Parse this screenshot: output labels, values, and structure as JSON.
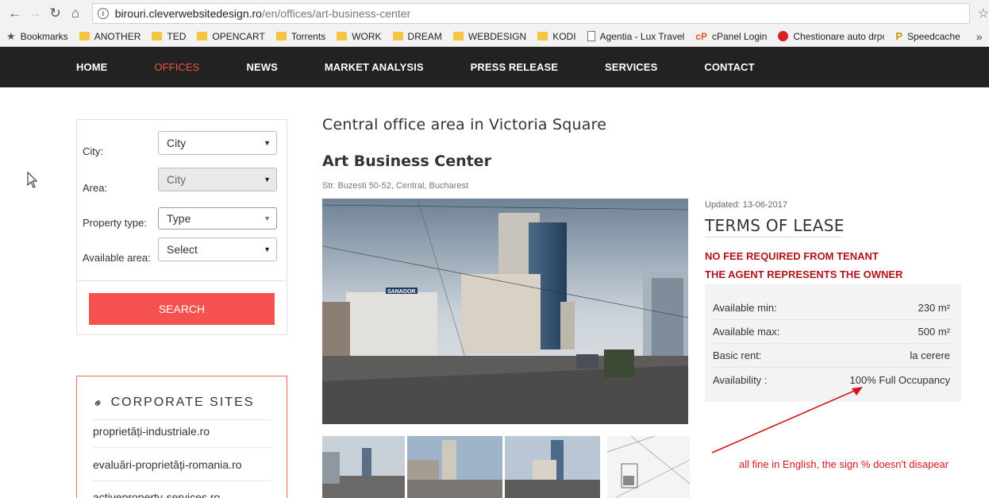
{
  "browser": {
    "url_host": "birouri.cleverwebsitedesign.ro",
    "url_path": "/en/offices/art-business-center",
    "bookmarks": [
      {
        "label": "Bookmarks",
        "icon": "star-icon"
      },
      {
        "label": "ANOTHER",
        "icon": "folder-icon"
      },
      {
        "label": "TED",
        "icon": "folder-icon"
      },
      {
        "label": "OPENCART",
        "icon": "folder-icon"
      },
      {
        "label": "Torrents",
        "icon": "folder-icon"
      },
      {
        "label": "WORK",
        "icon": "folder-icon"
      },
      {
        "label": "DREAM",
        "icon": "folder-icon"
      },
      {
        "label": "WEBDESIGN",
        "icon": "folder-icon"
      },
      {
        "label": "KODI",
        "icon": "folder-icon"
      },
      {
        "label": "Agentia - Lux Travel",
        "icon": "page-icon"
      },
      {
        "label": "cPanel Login",
        "icon": "cpanel-icon"
      },
      {
        "label": "Chestionare auto drpc",
        "icon": "stop-icon"
      },
      {
        "label": "Speedcache",
        "icon": "speedcache-icon"
      }
    ],
    "more": "»"
  },
  "nav": {
    "items": [
      "HOME",
      "OFFICES",
      "NEWS",
      "MARKET ANALYSIS",
      "PRESS RELEASE",
      "SERVICES",
      "CONTACT"
    ],
    "active_index": 1
  },
  "filter": {
    "city_label": "City:",
    "city_value": "City",
    "area_label": "Area:",
    "area_value": "City",
    "type_label": "Property type:",
    "type_value": "Type",
    "avail_label": "Available area:",
    "avail_value": "Select",
    "search_label": "SEARCH"
  },
  "corporate": {
    "title": "CORPORATE SITES",
    "items": [
      "proprietăți-industriale.ro",
      "evaluări-proprietăți-romania.ro",
      "activeproperty-services.ro"
    ]
  },
  "main": {
    "heading": "Central office area in Victoria Square",
    "building": "Art Business Center",
    "address": "Str. Buzesti 50-52, Central, Bucharest",
    "photo_sign": "SANADOR"
  },
  "lease": {
    "updated": "Updated: 13-06-2017",
    "title": "TERMS OF LEASE",
    "no_fee": "NO FEE REQUIRED FROM TENANT",
    "agent": "THE AGENT REPRESENTS THE OWNER",
    "rows": [
      {
        "label": "Available min:",
        "value": "230 m²"
      },
      {
        "label": "Available max:",
        "value": "500 m²"
      },
      {
        "label": "Basic rent:",
        "value": "la cerere"
      },
      {
        "label": "Availability :",
        "value": "100% Full Occupancy"
      }
    ]
  },
  "annotation": {
    "note": "all fine in English, the sign % doesn't disapear",
    "color": "#d4161a"
  },
  "colors": {
    "accent": "#f5524f",
    "nav_bg": "#222222",
    "nav_active": "#e8544a",
    "warning_text": "#b0141a"
  }
}
